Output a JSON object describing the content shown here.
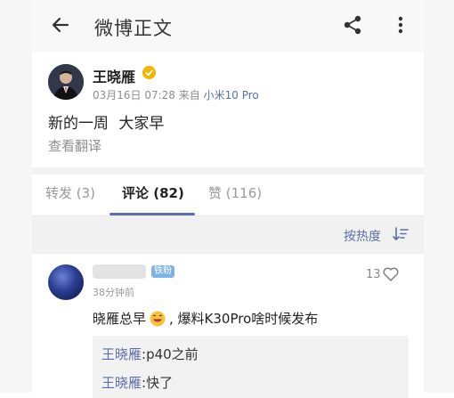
{
  "header": {
    "title": "微博正文"
  },
  "post": {
    "author": "王晓雁",
    "date": "03月16日 07:28",
    "source_prefix": "来自",
    "source": "小米10 Pro",
    "content": "新的一周 大家早",
    "translate": "查看翻译"
  },
  "tabs": [
    {
      "label": "转发 (3)"
    },
    {
      "label": "评论 (82)"
    },
    {
      "label": "赞 (116)"
    }
  ],
  "sort": {
    "label": "按热度"
  },
  "comment": {
    "tag": "铁粉",
    "time": "38分钟前",
    "likes": "13",
    "text_before": "晓雁总早",
    "text_after": ", 爆料K30Pro啥时候发布",
    "replies": [
      {
        "name": "王晓雁",
        "text": ":p40之前"
      },
      {
        "name": "王晓雁",
        "text": ":快了"
      }
    ]
  },
  "colors": {
    "link": "#5a6fa6",
    "accent": "#5b6fae",
    "verified": "#f2b600"
  }
}
